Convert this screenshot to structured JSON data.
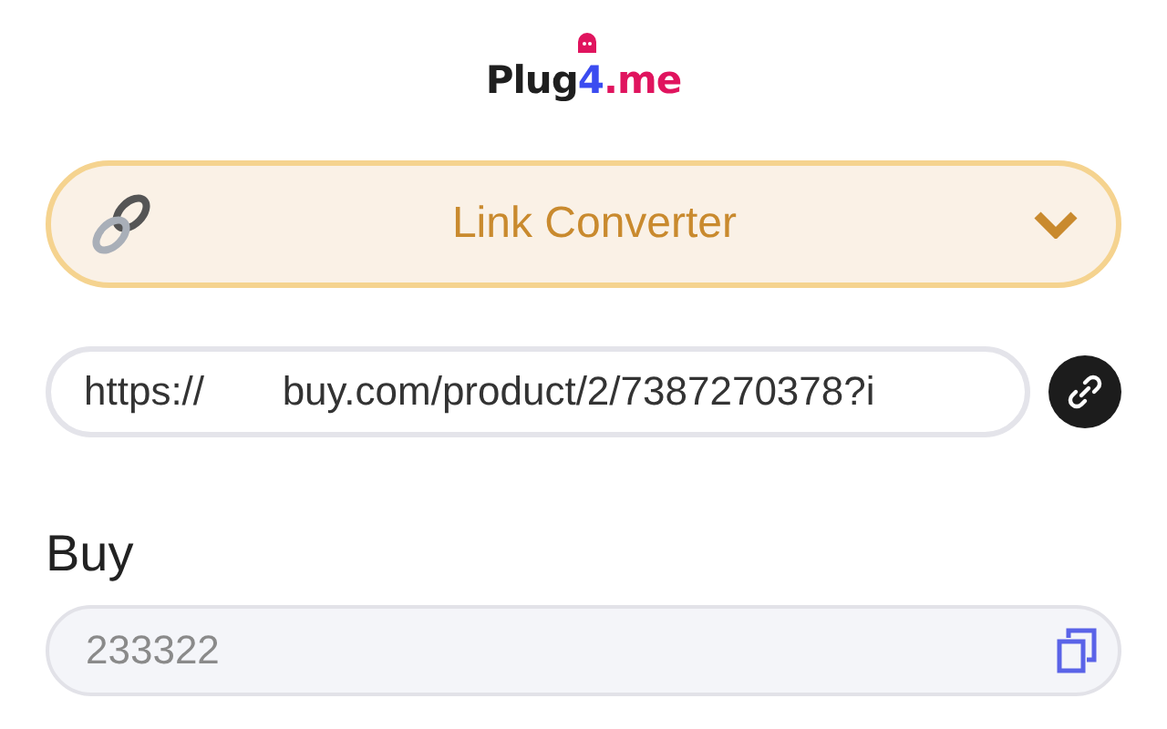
{
  "logo": {
    "parts": [
      {
        "text": "Plug",
        "color": "#1f1f1f"
      },
      {
        "text": "4",
        "color": "#3b4cf0"
      },
      {
        "text": ".me",
        "color": "#e0145e"
      }
    ]
  },
  "converter": {
    "title": "Link Converter",
    "expanded": false
  },
  "url_field": {
    "value": "https://       buy.com/product/2/7387270378?i"
  },
  "output": {
    "label": "Buy",
    "placeholder": "233322"
  }
}
